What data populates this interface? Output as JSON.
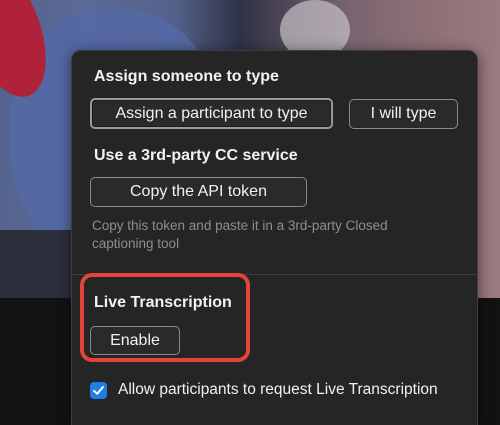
{
  "assign_section": {
    "title": "Assign someone to type",
    "assign_participant_label": "Assign a participant to type",
    "i_will_type_label": "I will type"
  },
  "third_party_section": {
    "title": "Use a 3rd-party CC service",
    "copy_token_label": "Copy the API token",
    "hint": "Copy this token and paste it in a 3rd-party Closed captioning tool"
  },
  "live_transcription": {
    "title": "Live Transcription",
    "enable_label": "Enable",
    "allow_request_label": "Allow participants to request Live Transcription",
    "allow_request_checked": true
  },
  "colors": {
    "popup_bg": "#252526",
    "highlight": "#e2443a",
    "checkbox_accent": "#1f7ee6"
  },
  "icons": {
    "checkbox": "checkmark-icon"
  }
}
